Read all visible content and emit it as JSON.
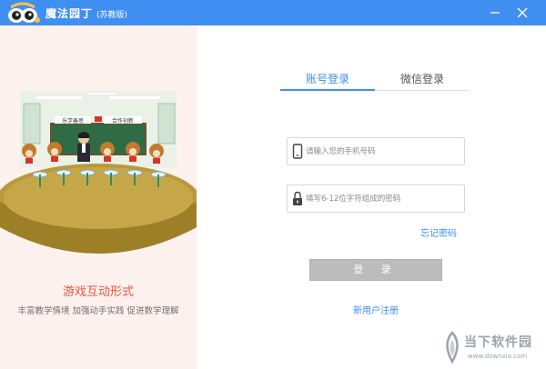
{
  "window": {
    "app_title": "魔法园丁",
    "app_edition": "(苏教版)"
  },
  "left": {
    "blackboard_tags": [
      "乐学善思",
      "合作创新"
    ],
    "promo_title": "游戏互动形式",
    "promo_subtitle": "丰富教学情境  加强动手实践  促进数学理解"
  },
  "login": {
    "tabs": [
      {
        "label": "账号登录",
        "active": true
      },
      {
        "label": "微信登录",
        "active": false
      }
    ],
    "phone_placeholder": "请输入您的手机号码",
    "password_placeholder": "填写6-12位字符组成的密码",
    "forgot_label": "忘记密码",
    "login_label": "登 录",
    "register_label": "新用户注册"
  },
  "watermark": {
    "brand": "当下软件园",
    "url": "www.downxia.com"
  },
  "colors": {
    "accent": "#3f8ef2",
    "promo_text": "#e8553e",
    "left_bg": "#fdf1ee",
    "disabled_button": "#bcbcbc"
  },
  "icons": [
    "mascot-logo-icon",
    "minimize-icon",
    "close-icon",
    "phone-icon",
    "lock-icon",
    "watermark-logo-icon"
  ]
}
